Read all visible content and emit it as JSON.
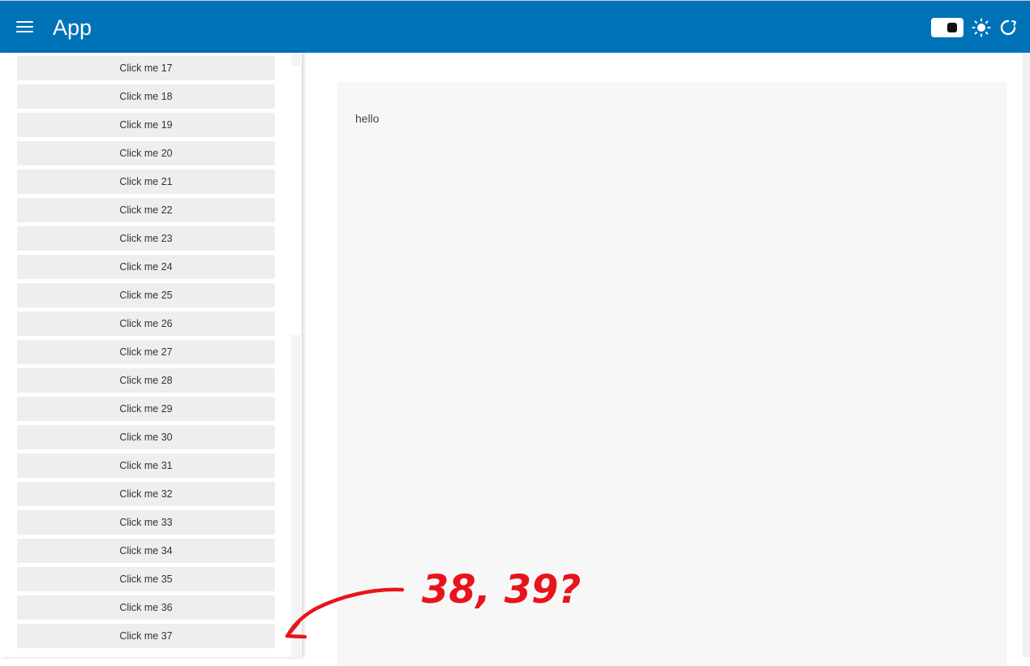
{
  "header": {
    "title": "App",
    "background_color": "#0072b8"
  },
  "sidebar": {
    "buttons": [
      "Click me 17",
      "Click me 18",
      "Click me 19",
      "Click me 20",
      "Click me 21",
      "Click me 22",
      "Click me 23",
      "Click me 24",
      "Click me 25",
      "Click me 26",
      "Click me 27",
      "Click me 28",
      "Click me 29",
      "Click me 30",
      "Click me 31",
      "Click me 32",
      "Click me 33",
      "Click me 34",
      "Click me 35",
      "Click me 36",
      "Click me 37"
    ]
  },
  "main": {
    "card_text": "hello"
  },
  "annotation": {
    "text": "38, 39?",
    "color": "#e8141c"
  },
  "icons": {
    "menu": "hamburger-menu-icon",
    "toggle": "dark-mode-toggle",
    "theme": "sun-icon",
    "refresh": "refresh-icon"
  }
}
